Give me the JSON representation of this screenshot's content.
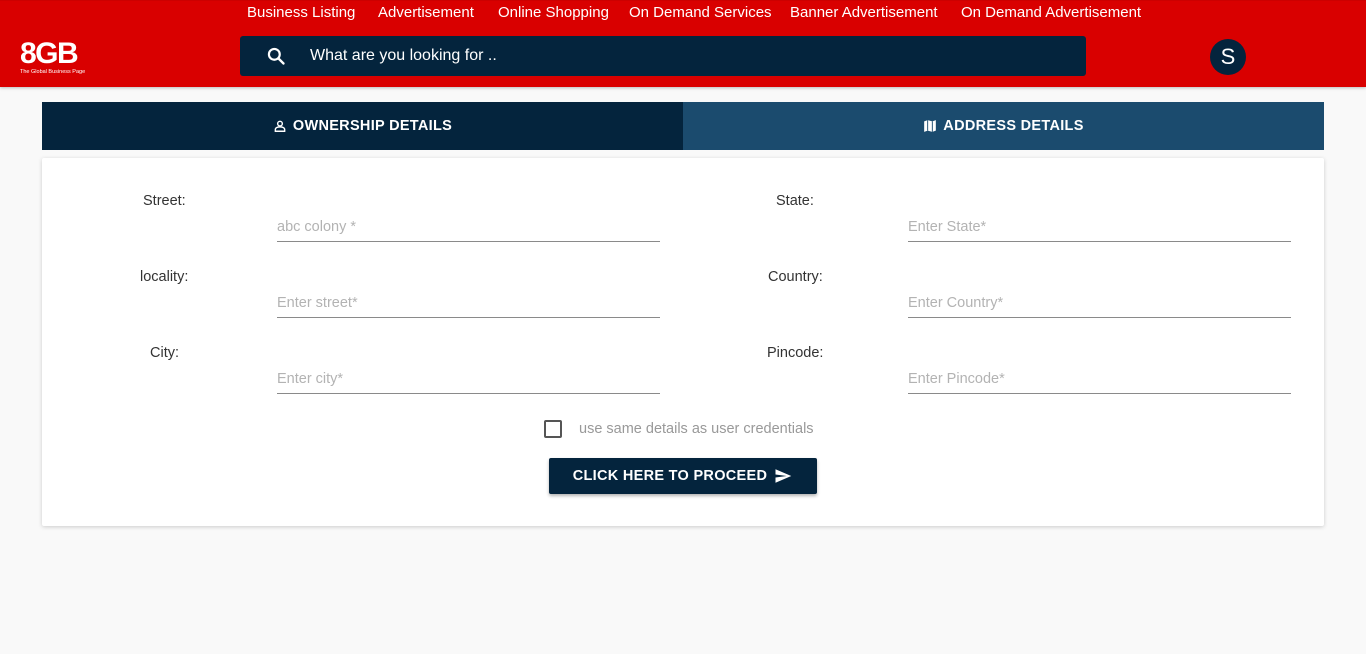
{
  "nav": {
    "items": [
      {
        "label": "Business Listing"
      },
      {
        "label": "Advertisement"
      },
      {
        "label": "Online Shopping"
      },
      {
        "label": "On Demand Services"
      },
      {
        "label": "Banner Advertisement"
      },
      {
        "label": "On Demand Advertisement"
      }
    ]
  },
  "logo": {
    "main": "8GB",
    "tagline": "The Global Business Page"
  },
  "search": {
    "placeholder": "What are you looking for ..",
    "icon": "search-icon"
  },
  "user": {
    "avatar_letter": "S"
  },
  "tabs": [
    {
      "label": "OWNERSHIP DETAILS",
      "icon": "person-icon"
    },
    {
      "label": "ADDRESS DETAILS",
      "icon": "map-icon"
    }
  ],
  "form": {
    "street": {
      "label": "Street:",
      "placeholder": "abc colony *",
      "value": ""
    },
    "locality": {
      "label": "locality:",
      "placeholder": "Enter street*",
      "value": ""
    },
    "city": {
      "label": "City:",
      "placeholder": "Enter city*",
      "value": ""
    },
    "state": {
      "label": "State:",
      "placeholder": "Enter State*",
      "value": ""
    },
    "country": {
      "label": "Country:",
      "placeholder": "Enter Country*",
      "value": ""
    },
    "pincode": {
      "label": "Pincode:",
      "placeholder": "Enter Pincode*",
      "value": ""
    },
    "same_details": {
      "label": "use same details as user credentials",
      "checked": false
    },
    "proceed_label": "CLICK HERE TO PROCEED"
  },
  "colors": {
    "header_red": "#d90000",
    "navy": "#04243d",
    "tab_active_blue": "#1b4b6e",
    "page_background": "#f9f9f9"
  }
}
